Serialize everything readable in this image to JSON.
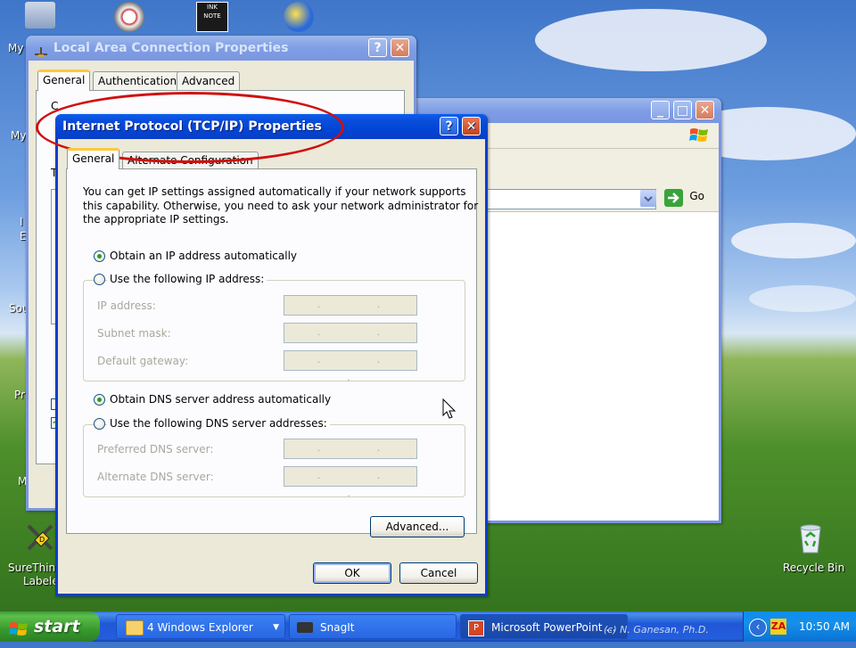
{
  "desktop": {
    "icons": [
      {
        "name": "My",
        "label": "My"
      },
      {
        "name": "My",
        "label": "My"
      },
      {
        "name": "Sou",
        "label": "Sou"
      },
      {
        "name": "Pr",
        "label": "Pr"
      },
      {
        "name": "SureThing Labeler",
        "label": "SureThin",
        "label2": "Labele"
      },
      {
        "name": "Recycle Bin",
        "label": "Recycle Bin"
      }
    ],
    "partial_labels": [
      "I",
      "E",
      "M"
    ]
  },
  "lac_window": {
    "title": "Local Area Connection Properties",
    "help_btn": "?",
    "close_btn": "✕",
    "tabs": [
      "General",
      "Authentication",
      "Advanced"
    ],
    "partial_text": [
      "C",
      "T"
    ]
  },
  "explorer_window": {
    "go_label": "Go",
    "minimize": "_",
    "maximize": "□",
    "close": "✕"
  },
  "tcpip_dialog": {
    "title": "Internet Protocol (TCP/IP) Properties",
    "help_btn": "?",
    "close_btn": "✕",
    "tabs": [
      "General",
      "Alternate Configuration"
    ],
    "intro": "You can get IP settings assigned automatically if your network supports this capability. Otherwise, you need to ask your network administrator for the appropriate IP settings.",
    "intro_lines": [
      "You can get IP settings assigned automatically if your network supports",
      "this capability. Otherwise, you need to ask your network administrator for",
      "the appropriate IP settings."
    ],
    "ip_auto": {
      "label": "Obtain an IP address automatically",
      "selected": true
    },
    "ip_manual": {
      "label": "Use the following IP address:",
      "selected": false
    },
    "ip_fields": [
      {
        "label": "IP address:",
        "value": ". . ."
      },
      {
        "label": "Subnet mask:",
        "value": ". . ."
      },
      {
        "label": "Default gateway:",
        "value": ". . ."
      }
    ],
    "dns_auto": {
      "label": "Obtain DNS server address automatically",
      "selected": true
    },
    "dns_manual": {
      "label": "Use the following DNS server addresses:",
      "selected": false
    },
    "dns_fields": [
      {
        "label": "Preferred DNS server:",
        "value": ". . ."
      },
      {
        "label": "Alternate DNS server:",
        "value": ". . ."
      }
    ],
    "advanced_btn": "Advanced...",
    "ok_btn": "OK",
    "cancel_btn": "Cancel"
  },
  "taskbar": {
    "start_label": "start",
    "items": [
      {
        "label": "4 Windows Explorer",
        "icon": "folder-icon"
      },
      {
        "label": "SnagIt",
        "icon": "camera-icon"
      },
      {
        "label": "Microsoft PowerPoint ...",
        "icon": "powerpoint-icon"
      }
    ],
    "clock": "10:50 AM",
    "watermark": "(c) N. Ganesan, Ph.D."
  },
  "colors": {
    "highlight_ellipse": "#d01010",
    "xp_blue": "#0a3fcf",
    "dialog_bg": "#ece9d8"
  }
}
